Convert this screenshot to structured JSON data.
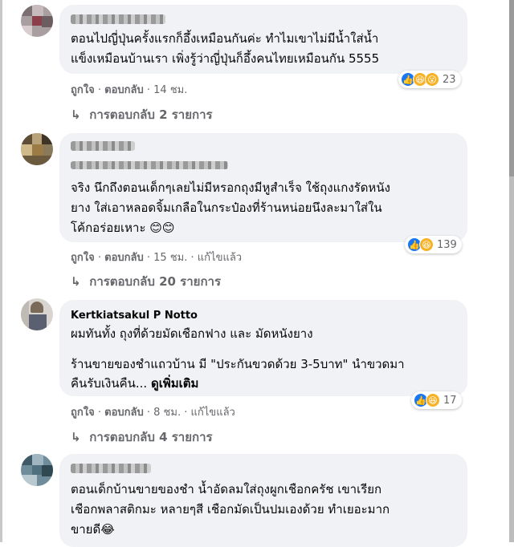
{
  "comments": [
    {
      "author": "",
      "lines": [
        "ตอนไปญี่ปุ่นครั้งแรกก็อึ้งเหมือนกันค่ะ ทำไมเขาไม่มีน้ำใส่น้ำ",
        "แข็งเหมือนบ้านเรา เพิ่งรู้ว่าญี่ปุ่นก็อึ้งคนไทยเหมือนกัน 5555"
      ],
      "reaction_icons": [
        "like-icon",
        "haha-icon",
        "wow-icon"
      ],
      "reaction_count": "23",
      "like": "ถูกใจ",
      "reply": "ตอบกลับ",
      "time": "14 ชม.",
      "edited": "",
      "replies_label": "การตอบกลับ 2 รายการ"
    },
    {
      "author": "",
      "lines": [
        "จริง นึกถึงตอนเด็กๆเลยไม่มีหรอกถุงมีหูสำเร็จ ใช้ถุงแกงรัดหนัง",
        "ยาง ใส่เอาหลอดจิ้มเกลือในกระป๋องที่ร้านหน่อยนึงละมาใส่ใน",
        "โค้กอร่อยเหาะ 😊😊"
      ],
      "reaction_icons": [
        "like-icon",
        "haha-icon"
      ],
      "reaction_count": "139",
      "like": "ถูกใจ",
      "reply": "ตอบกลับ",
      "time": "15 ชม.",
      "edited": "แก้ไขแล้ว",
      "replies_label": "การตอบกลับ 20 รายการ"
    },
    {
      "author": "Kertkiatsakul P Notto",
      "lines": [
        "ผมทันทั้ง ถุงที่ด้วยมัดเชือกฟาง และ มัดหนังยาง",
        "",
        "ร้านขายของชำแถวบ้าน มี \"ประกันขวดด้วย 3-5บาท\" นำขวดมา",
        "คืนรับเงินคืน..."
      ],
      "see_more": "ดูเพิ่มเติม",
      "reaction_icons": [
        "like-icon",
        "haha-icon"
      ],
      "reaction_count": "17",
      "like": "ถูกใจ",
      "reply": "ตอบกลับ",
      "time": "8 ชม.",
      "edited": "แก้ไขแล้ว",
      "replies_label": "การตอบกลับ 4 รายการ"
    },
    {
      "author": "",
      "lines": [
        "ตอนเด็กบ้านขายของชำ น้ำอัดลมใส่ถุงผูกเชือกครัช เขาเรียก",
        "เชือกพลาสติกมะ หลายๆสี เชือกมัดเป็นปมเองด้วย ทำเยอะมาก",
        "ขายดี😂"
      ]
    }
  ],
  "separator": "·",
  "reply_arrow": "↳",
  "colors": {
    "bubble": "#f0f2f5",
    "meta": "#65676b",
    "like_blue": "#1877f2",
    "haha_yellow": "#f7b125"
  }
}
